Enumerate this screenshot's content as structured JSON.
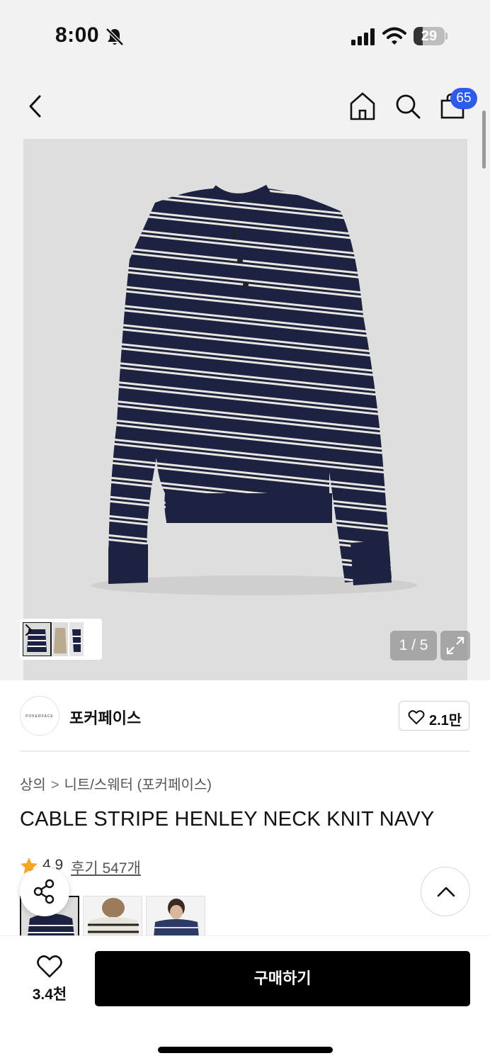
{
  "status_bar": {
    "time": "8:00",
    "battery": {
      "level": "29",
      "fraction": 0.29
    },
    "icons": [
      "bell-slash-icon",
      "signal-icon",
      "wifi-icon",
      "battery-icon"
    ]
  },
  "nav": {
    "icons": [
      "chevron-left-icon",
      "home-icon",
      "search-icon",
      "shopping-bag-icon"
    ],
    "cart_count": "65"
  },
  "gallery": {
    "counter": "1 / 5",
    "current": 1,
    "total": 5,
    "icons": [
      "chevron-right-icon",
      "expand-icon"
    ]
  },
  "brand": {
    "logo_text": "POKERFACE",
    "name": "포커페이스",
    "like_count": "2.1만"
  },
  "breadcrumb": {
    "items": [
      "상의",
      "니트/스웨터 (포커페이스)"
    ]
  },
  "product": {
    "title": "CABLE STRIPE HENLEY NECK KNIT NAVY",
    "rating": "4.9",
    "reviews": "후기 547개"
  },
  "floating": {
    "icons": [
      "share-icon",
      "chevron-up-icon"
    ]
  },
  "bottom_bar": {
    "wish_count": "3.4천",
    "buy_label": "구매하기"
  },
  "colors": {
    "navy": "#1c2240",
    "badge_blue": "#2f5bea",
    "star": "#f5a623",
    "buy_button": "#000000"
  }
}
